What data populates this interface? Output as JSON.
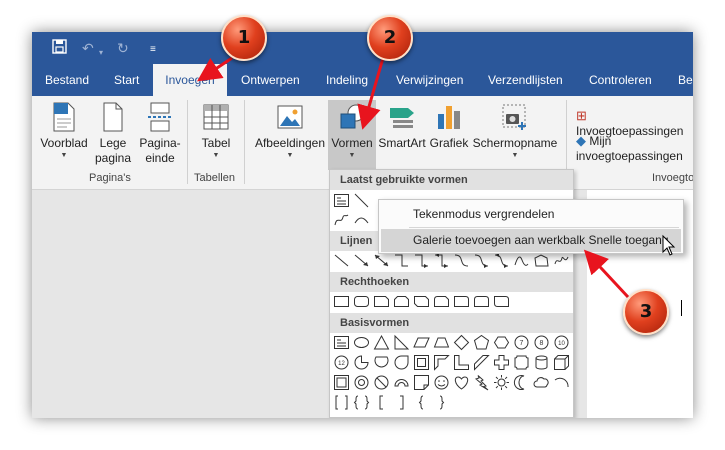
{
  "quick_access": {
    "save_icon": "save-icon",
    "undo_icon": "undo-icon",
    "redo_icon": "redo-icon",
    "customize_icon": "customize-qat-icon"
  },
  "tabs": [
    {
      "label": "Bestand"
    },
    {
      "label": "Start"
    },
    {
      "label": "Invoegen",
      "active": true
    },
    {
      "label": "Ontwerpen"
    },
    {
      "label": "Indeling"
    },
    {
      "label": "Verwijzingen"
    },
    {
      "label": "Verzendlijsten"
    },
    {
      "label": "Controleren"
    },
    {
      "label": "Beeld"
    }
  ],
  "ribbon": {
    "groups": {
      "pages": "Pagina's",
      "tables": "Tabellen",
      "addins": "Invoegtoepassingen"
    },
    "buttons": {
      "voorblad": "Voorblad",
      "lege_pagina_1": "Lege",
      "lege_pagina_2": "pagina",
      "pagina_einde_1": "Pagina-",
      "pagina_einde_2": "einde",
      "tabel": "Tabel",
      "afbeeldingen": "Afbeeldingen",
      "vormen": "Vormen",
      "smartart": "SmartArt",
      "grafiek": "Grafiek",
      "schermopname": "Schermopname",
      "invoegtoepassingen": "Invoegtoepassingen",
      "mijn_invoegtoepassingen": "Mijn invoegtoepassingen"
    }
  },
  "shapes_gallery": {
    "sections": {
      "recent": "Laatst gebruikte vormen",
      "lines": "Lijnen",
      "rectangles": "Rechthoeken",
      "basic": "Basisvormen"
    }
  },
  "context_menu": {
    "items": [
      {
        "label": "Tekenmodus vergrendelen"
      },
      {
        "label": "Galerie toevoegen aan werkbalk Snelle toegang",
        "highlighted": true
      }
    ]
  },
  "callouts": [
    "1",
    "2",
    "3"
  ],
  "colors": {
    "title_bar": "#2b579a",
    "ribbon": "#f3f3f3",
    "badge": "#e0401e",
    "arrow": "#e8141e"
  }
}
